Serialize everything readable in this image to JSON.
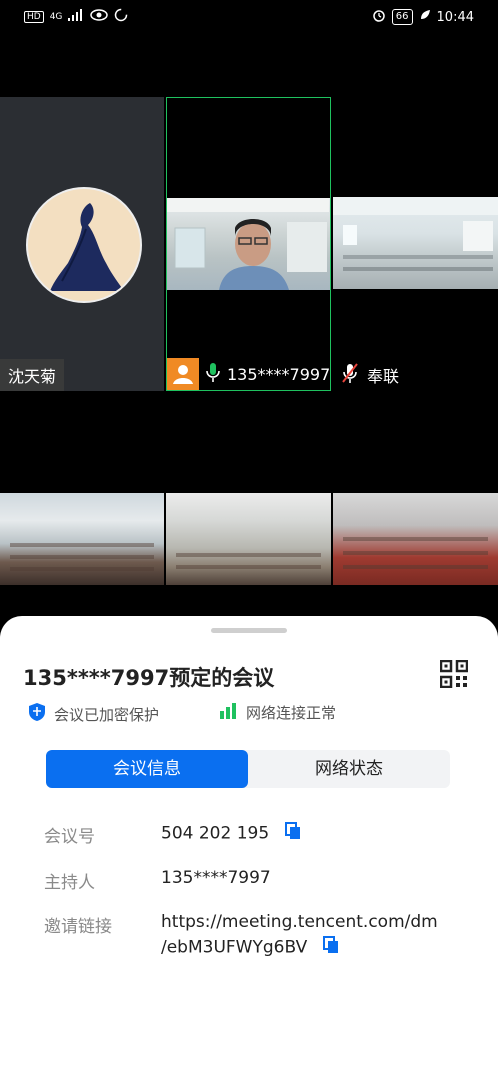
{
  "status_bar": {
    "left_icons": [
      "hd-icon",
      "4g-signal-icon",
      "eye-icon",
      "circle-icon"
    ],
    "network": "4G",
    "battery": "66",
    "time": "10:44"
  },
  "tiles": {
    "participant_1_name": "沈天菊",
    "speaker_name": "135****7997",
    "participant_3_name": "奉联"
  },
  "sheet": {
    "title": "135****7997预定的会议",
    "security": "会议已加密保护",
    "network_status": "网络连接正常",
    "tab_info": "会议信息",
    "tab_network": "网络状态",
    "meeting_id_label": "会议号",
    "meeting_id": "504 202 195",
    "host_label": "主持人",
    "host": "135****7997",
    "invite_label": "邀请链接",
    "invite_line1": "https://meeting.tencent.com/dm",
    "invite_line2": "/ebM3UFWYg6BV"
  },
  "colors": {
    "accent": "#0a6ff0",
    "speaker_border": "#1fc15f",
    "host_badge": "#f08a24"
  }
}
